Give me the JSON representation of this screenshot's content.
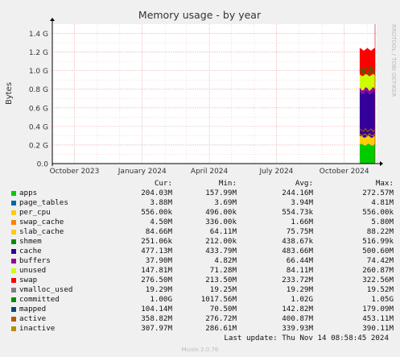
{
  "chart_data": {
    "type": "area",
    "title": "Memory usage - by year",
    "ylabel": "Bytes",
    "watermark": "RRDTOOL / TOBI OETIKER",
    "ylim": [
      0,
      1.5
    ],
    "y_unit": "G",
    "y_ticks": [
      "0.0",
      "0.2 G",
      "0.4 G",
      "0.6 G",
      "0.8 G",
      "1.0 G",
      "1.2 G",
      "1.4 G"
    ],
    "y_tick_values": [
      0,
      0.2,
      0.4,
      0.6,
      0.8,
      1.0,
      1.2,
      1.4
    ],
    "x_ticks": [
      "October 2023",
      "January 2024",
      "April 2024",
      "July 2024",
      "October 2024"
    ],
    "x_tick_dates": [
      "2023-10-01",
      "2024-01-01",
      "2024-04-01",
      "2024-07-01",
      "2024-10-01"
    ],
    "x_range": [
      "2023-09-01",
      "2024-11-14"
    ],
    "data_start": "2024-10-22",
    "series_approx_stack_at_end": [
      {
        "name": "apps",
        "value": 0.204
      },
      {
        "name": "slab_cache",
        "value": 0.085
      },
      {
        "name": "cache",
        "value": 0.477
      },
      {
        "name": "buffers",
        "value": 0.038
      },
      {
        "name": "unused",
        "value": 0.148
      },
      {
        "name": "swap",
        "value": 0.277
      }
    ],
    "lines_approx": [
      {
        "name": "committed",
        "value": 1.0
      },
      {
        "name": "active",
        "value": 0.359
      },
      {
        "name": "inactive",
        "value": 0.308
      }
    ]
  },
  "legend": {
    "headers": {
      "cur": "Cur:",
      "min": "Min:",
      "avg": "Avg:",
      "max": "Max:"
    },
    "rows": [
      {
        "name": "apps",
        "color": "#00cc00",
        "cur": "204.03M",
        "min": "157.99M",
        "avg": "244.16M",
        "max": "272.57M"
      },
      {
        "name": "page_tables",
        "color": "#0066b3",
        "cur": "3.88M",
        "min": "3.69M",
        "avg": "3.94M",
        "max": "4.81M"
      },
      {
        "name": "per_cpu",
        "color": "#ffcc00",
        "cur": "556.00k",
        "min": "496.00k",
        "avg": "554.73k",
        "max": "556.00k"
      },
      {
        "name": "swap_cache",
        "color": "#ff8000",
        "cur": "4.50M",
        "min": "336.00k",
        "avg": "1.66M",
        "max": "5.80M"
      },
      {
        "name": "slab_cache",
        "color": "#ffcc00",
        "cur": "84.66M",
        "min": "64.11M",
        "avg": "75.75M",
        "max": "88.22M"
      },
      {
        "name": "shmem",
        "color": "#008f00",
        "cur": "251.06k",
        "min": "212.00k",
        "avg": "438.67k",
        "max": "516.99k"
      },
      {
        "name": "cache",
        "color": "#330099",
        "cur": "477.13M",
        "min": "433.79M",
        "avg": "483.66M",
        "max": "500.60M"
      },
      {
        "name": "buffers",
        "color": "#990099",
        "cur": "37.90M",
        "min": "4.82M",
        "avg": "66.44M",
        "max": "74.42M"
      },
      {
        "name": "unused",
        "color": "#ccff00",
        "cur": "147.81M",
        "min": "71.28M",
        "avg": "84.11M",
        "max": "260.87M"
      },
      {
        "name": "swap",
        "color": "#ff0000",
        "cur": "276.50M",
        "min": "213.50M",
        "avg": "233.72M",
        "max": "322.56M"
      },
      {
        "name": "vmalloc_used",
        "color": "#808080",
        "cur": "19.29M",
        "min": "19.25M",
        "avg": "19.29M",
        "max": "19.52M"
      },
      {
        "name": "committed",
        "color": "#008f00",
        "cur": "1.00G",
        "min": "1017.56M",
        "avg": "1.02G",
        "max": "1.05G"
      },
      {
        "name": "mapped",
        "color": "#00487d",
        "cur": "104.14M",
        "min": "70.50M",
        "avg": "142.82M",
        "max": "179.09M"
      },
      {
        "name": "active",
        "color": "#b35a00",
        "cur": "358.82M",
        "min": "276.72M",
        "avg": "400.87M",
        "max": "453.11M"
      },
      {
        "name": "inactive",
        "color": "#b38f00",
        "cur": "307.97M",
        "min": "286.61M",
        "avg": "339.93M",
        "max": "390.11M"
      }
    ]
  },
  "footer": {
    "last_update": "Last update: Thu Nov 14 08:58:45 2024",
    "version": "Munin 2.0.76"
  }
}
